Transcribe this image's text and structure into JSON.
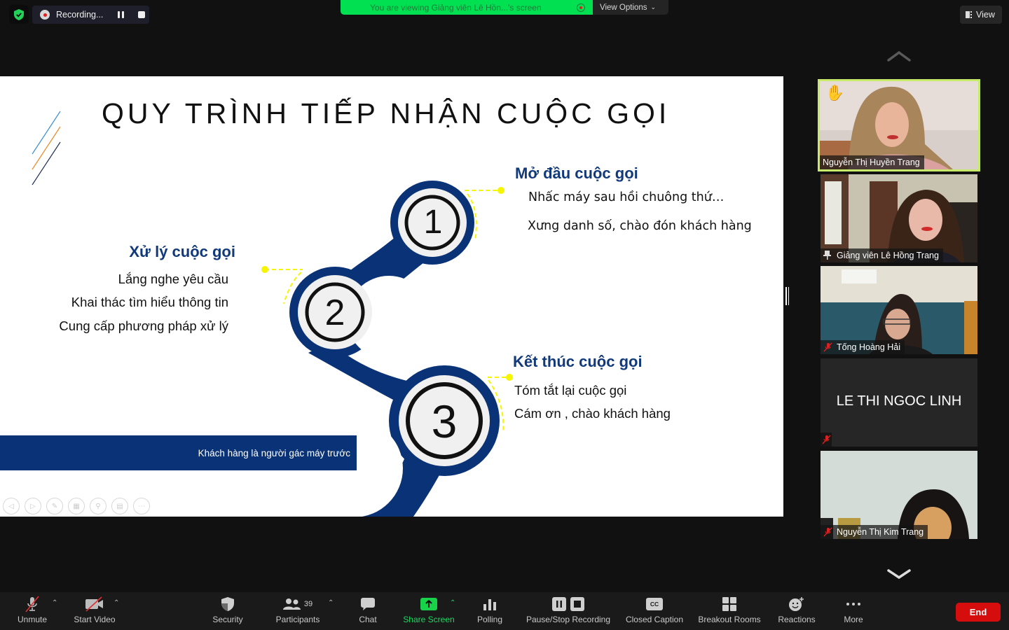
{
  "top_bar": {
    "recording_label": "Recording...",
    "viewing_banner": "You are viewing Giảng viên Lê Hồn...'s screen",
    "view_options_label": "View Options",
    "view_label": "View"
  },
  "slide": {
    "title": "QUY TRÌNH TIẾP NHẬN CUỘC GỌI",
    "steps": [
      {
        "number": "1",
        "heading": "Mở đầu cuộc gọi",
        "bullets": [
          "Nhấc máy sau hồi chuông thứ…",
          "Xưng danh số, chào đón khách hàng"
        ]
      },
      {
        "number": "2",
        "heading": "Xử lý cuộc gọi",
        "bullets": [
          "Lắng nghe yêu cầu",
          "Khai thác tìm hiểu thông tin",
          "Cung cấp phương pháp xử lý"
        ]
      },
      {
        "number": "3",
        "heading": "Kết thúc cuộc gọi",
        "bullets": [
          "Tóm tắt lại cuộc gọi",
          "Cám ơn , chào khách hàng"
        ]
      }
    ],
    "footer_note": "Khách hàng là người gác máy trước",
    "colors": {
      "primary": "#0a3377",
      "accent": "#f5f500"
    }
  },
  "gallery": {
    "participants": [
      {
        "name": "Nguyễn Thị Huyền Trang",
        "state": "hand-raised",
        "active_speaker": true
      },
      {
        "name": "Giảng viên Lê Hồng Trang",
        "state": "pinned"
      },
      {
        "name": "Tống Hoàng Hải",
        "state": "muted"
      },
      {
        "name": "LE THI NGOC LINH",
        "state": "muted-no-video"
      },
      {
        "name": "Nguyễn Thị Kim Trang",
        "state": "muted"
      }
    ]
  },
  "toolbar": {
    "unmute": "Unmute",
    "start_video": "Start Video",
    "security": "Security",
    "participants": "Participants",
    "participants_count": "39",
    "chat": "Chat",
    "share_screen": "Share Screen",
    "polling": "Polling",
    "pause_stop_recording": "Pause/Stop Recording",
    "closed_caption": "Closed Caption",
    "cc_badge": "CC",
    "breakout_rooms": "Breakout Rooms",
    "reactions": "Reactions",
    "more": "More",
    "end": "End"
  }
}
